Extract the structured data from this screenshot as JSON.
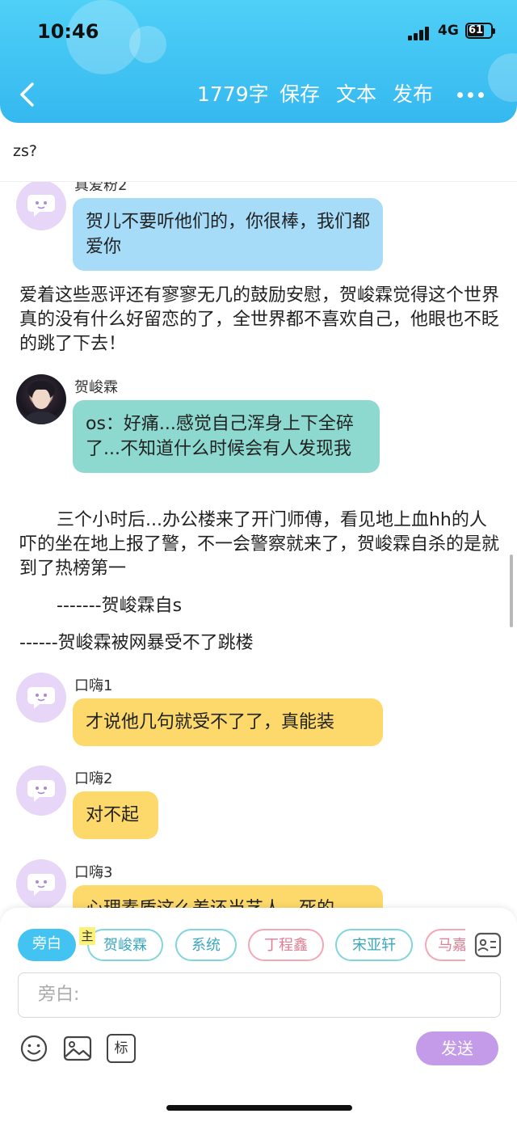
{
  "status_bar": {
    "time": "10:46",
    "network": "4G",
    "battery": "61"
  },
  "nav": {
    "word_count": "1779字",
    "save": "保存",
    "text": "文本",
    "publish": "发布"
  },
  "title": "zs?",
  "messages": {
    "m1": {
      "name": "真爱粉2",
      "text": "贺儿不要听他们的，你很棒，我们都爱你"
    },
    "narration1": "爱着这些恶评还有寥寥无几的鼓励安慰，贺峻霖觉得这个世界真的没有什么好留恋的了，全世界都不喜欢自己，他眼也不眨的跳了下去！",
    "m2": {
      "name": "贺峻霖",
      "text": "os：好痛...感觉自己浑身上下全碎了...不知道什么时候会有人发现我"
    },
    "narration2": "三个小时后...办公楼来了开门师傅，看见地上血hh的人吓的坐在地上报了警，不一会警察就来了，贺峻霖自杀的是就到了热榜第一",
    "narration3": "-------贺峻霖自s",
    "narration4": "------贺峻霖被网暴受不了跳楼",
    "m3": {
      "name": "口嗨1",
      "text": "才说他几句就受不了了，真能装"
    },
    "m4": {
      "name": "口嗨2",
      "text": "对不起"
    },
    "m5": {
      "name": "口嗨3",
      "text": "心理素质这么差还当艺人，死的"
    }
  },
  "roles": {
    "narrator": "旁白",
    "main_tag": "主",
    "r1": "贺峻霖",
    "r2": "系统",
    "r3": "丁程鑫",
    "r4": "宋亚轩",
    "r5": "马嘉"
  },
  "input": {
    "placeholder": "旁白:"
  },
  "toolbar": {
    "mark_label": "标",
    "send_label": "发送"
  },
  "colors": {
    "header": "#35b8ef",
    "bubble_blue": "#a6dcf8",
    "bubble_teal": "#8dd9cf",
    "bubble_yellow": "#fcd96a",
    "send": "#c39be8"
  }
}
